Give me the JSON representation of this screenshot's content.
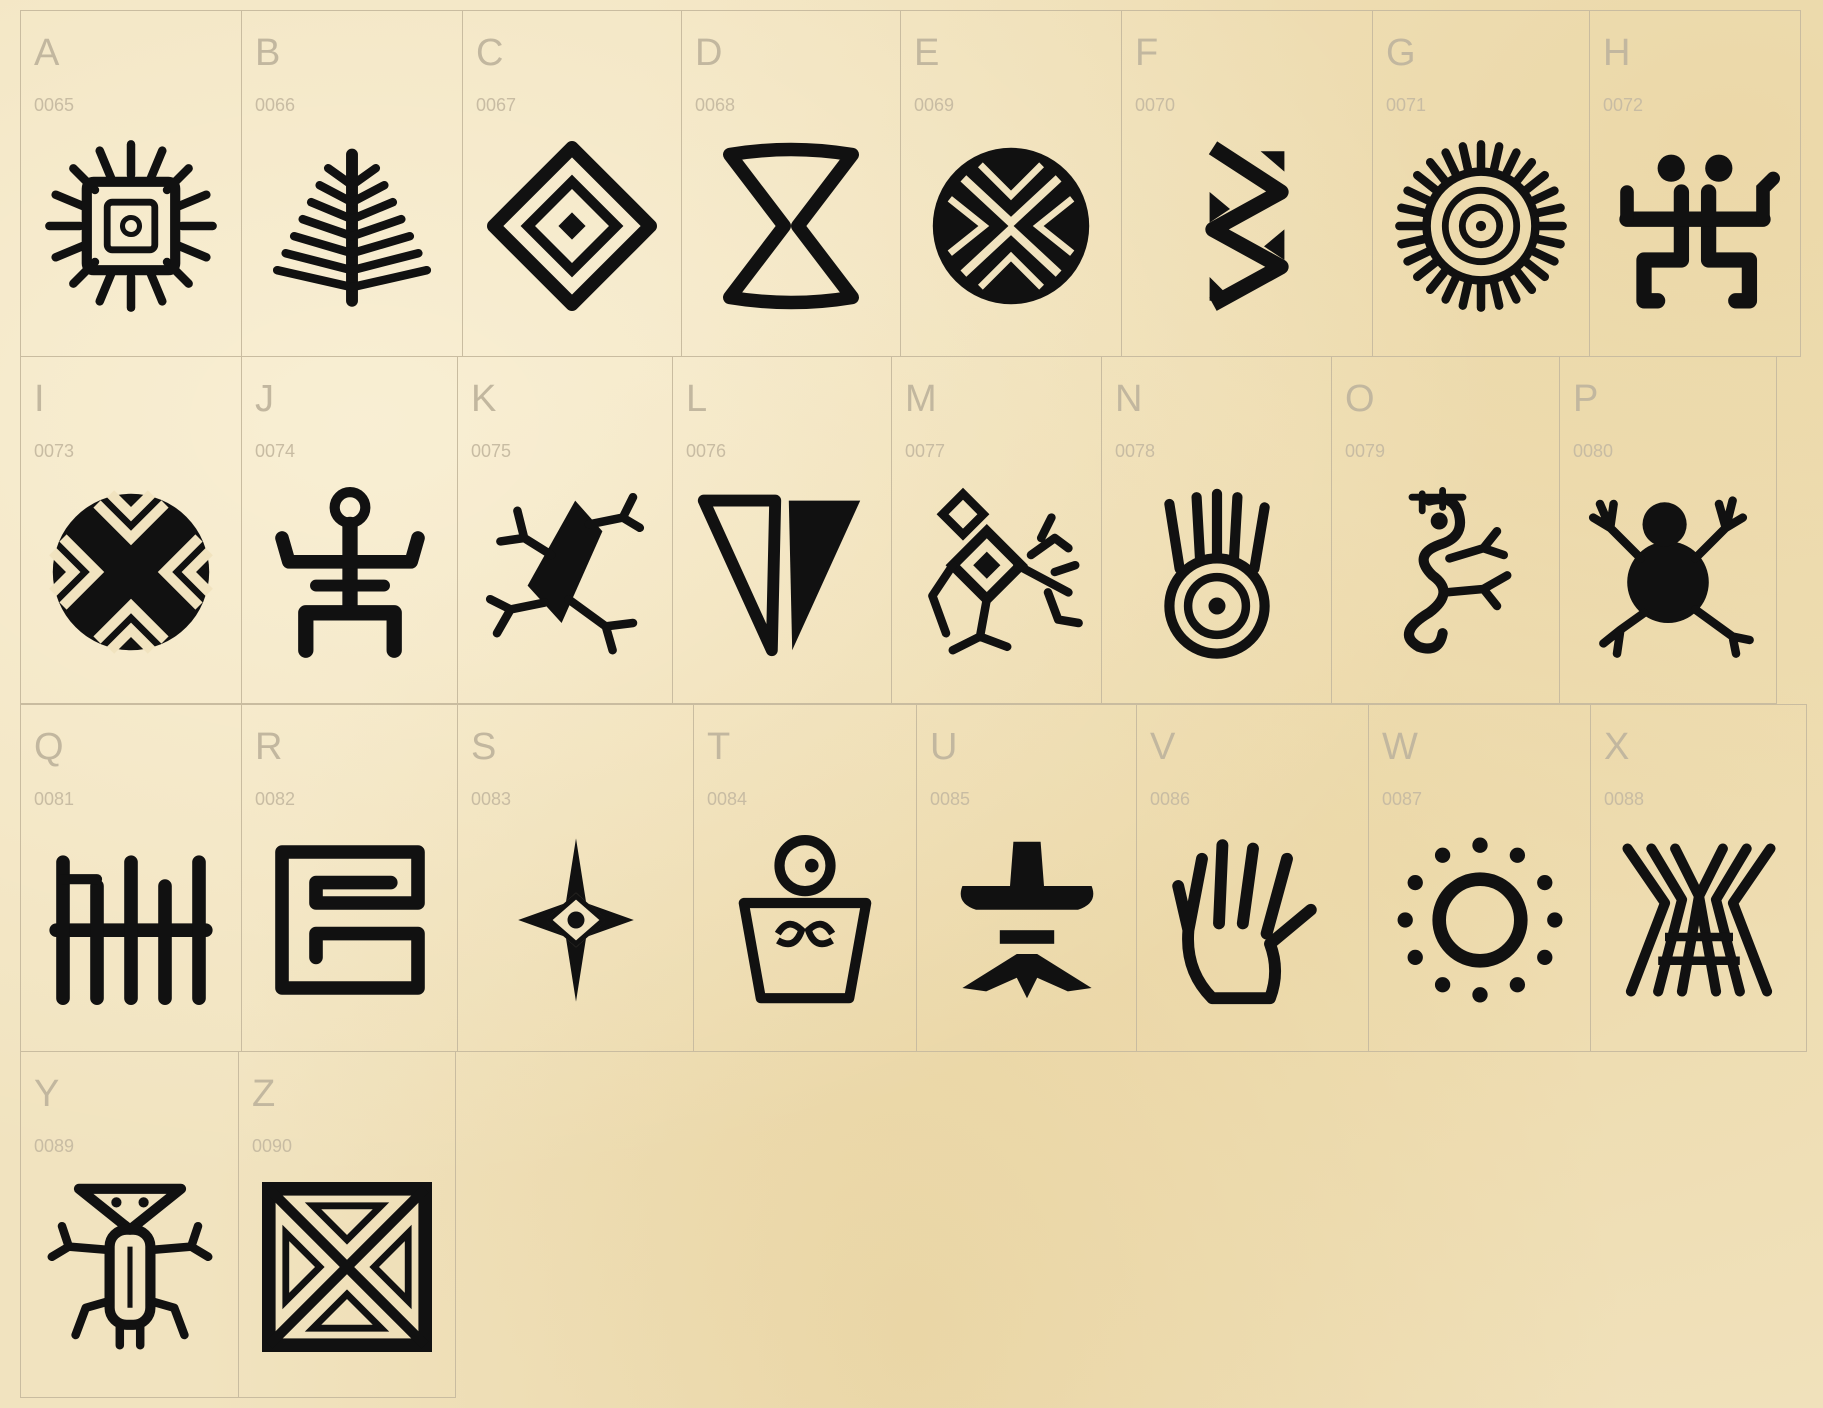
{
  "glyph_rows": [
    [
      {
        "letter": "A",
        "code": "0065",
        "glyph": "sun-square-icon"
      },
      {
        "letter": "B",
        "code": "0066",
        "glyph": "fern-leaf-icon"
      },
      {
        "letter": "C",
        "code": "0067",
        "glyph": "nested-diamond-icon"
      },
      {
        "letter": "D",
        "code": "0068",
        "glyph": "hourglass-icon"
      },
      {
        "letter": "E",
        "code": "0069",
        "glyph": "chevron-circle-icon"
      },
      {
        "letter": "F",
        "code": "0070",
        "glyph": "zigzag-band-icon"
      },
      {
        "letter": "G",
        "code": "0071",
        "glyph": "spiral-sun-icon"
      },
      {
        "letter": "H",
        "code": "0072",
        "glyph": "frog-figure-icon"
      }
    ],
    [
      {
        "letter": "I",
        "code": "0073",
        "glyph": "chevron-disc-icon"
      },
      {
        "letter": "J",
        "code": "0074",
        "glyph": "human-figure-icon"
      },
      {
        "letter": "K",
        "code": "0075",
        "glyph": "lizard-icon"
      },
      {
        "letter": "L",
        "code": "0076",
        "glyph": "split-triangle-icon"
      },
      {
        "letter": "M",
        "code": "0077",
        "glyph": "diamond-figure-icon"
      },
      {
        "letter": "N",
        "code": "0078",
        "glyph": "headdress-eye-icon"
      },
      {
        "letter": "O",
        "code": "0079",
        "glyph": "seahorse-icon"
      },
      {
        "letter": "P",
        "code": "0080",
        "glyph": "frog-icon"
      }
    ],
    [
      {
        "letter": "Q",
        "code": "0081",
        "glyph": "comb-icon"
      },
      {
        "letter": "R",
        "code": "0082",
        "glyph": "meander-icon"
      },
      {
        "letter": "S",
        "code": "0083",
        "glyph": "star-eye-icon"
      },
      {
        "letter": "T",
        "code": "0084",
        "glyph": "idol-icon"
      },
      {
        "letter": "U",
        "code": "0085",
        "glyph": "hat-figure-icon"
      },
      {
        "letter": "V",
        "code": "0086",
        "glyph": "hand-icon"
      },
      {
        "letter": "W",
        "code": "0087",
        "glyph": "dotted-sun-icon"
      },
      {
        "letter": "X",
        "code": "0088",
        "glyph": "spider-icon"
      }
    ],
    [
      {
        "letter": "Y",
        "code": "0089",
        "glyph": "masked-figure-icon"
      },
      {
        "letter": "Z",
        "code": "0090",
        "glyph": "triangle-square-icon"
      }
    ]
  ]
}
